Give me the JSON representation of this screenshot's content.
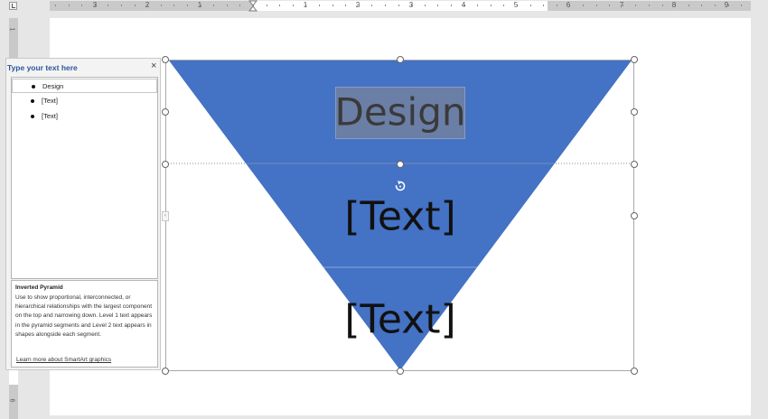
{
  "ruler": {
    "top_numbers": [
      "3",
      "2",
      "1",
      "1",
      "2",
      "3",
      "4",
      "5",
      "6",
      "7",
      "8",
      "9"
    ],
    "left_numbers": [
      "1",
      "6"
    ]
  },
  "text_pane": {
    "title": "Type your text here",
    "close": "×",
    "items": [
      "Design",
      "[Text]",
      "[Text]"
    ],
    "description_title": "Inverted Pyramid",
    "description": "Use to show proportional, interconnected, or hierarchical relationships with the largest component on the top and narrowing down. Level 1 text appears in the pyramid segments and Level 2 text appears in shapes alongside each segment.",
    "learn_more": "Learn more about SmartArt graphics"
  },
  "smartart": {
    "layout": "Inverted Pyramid",
    "segments": [
      "Design",
      "[Text]",
      "[Text]"
    ],
    "fill_color": "#4472c4",
    "selected_text_bg": "#6b7ea5"
  },
  "icons": {
    "rotate": "rotate-icon",
    "close": "close-icon",
    "bullet": "bullet-icon"
  }
}
